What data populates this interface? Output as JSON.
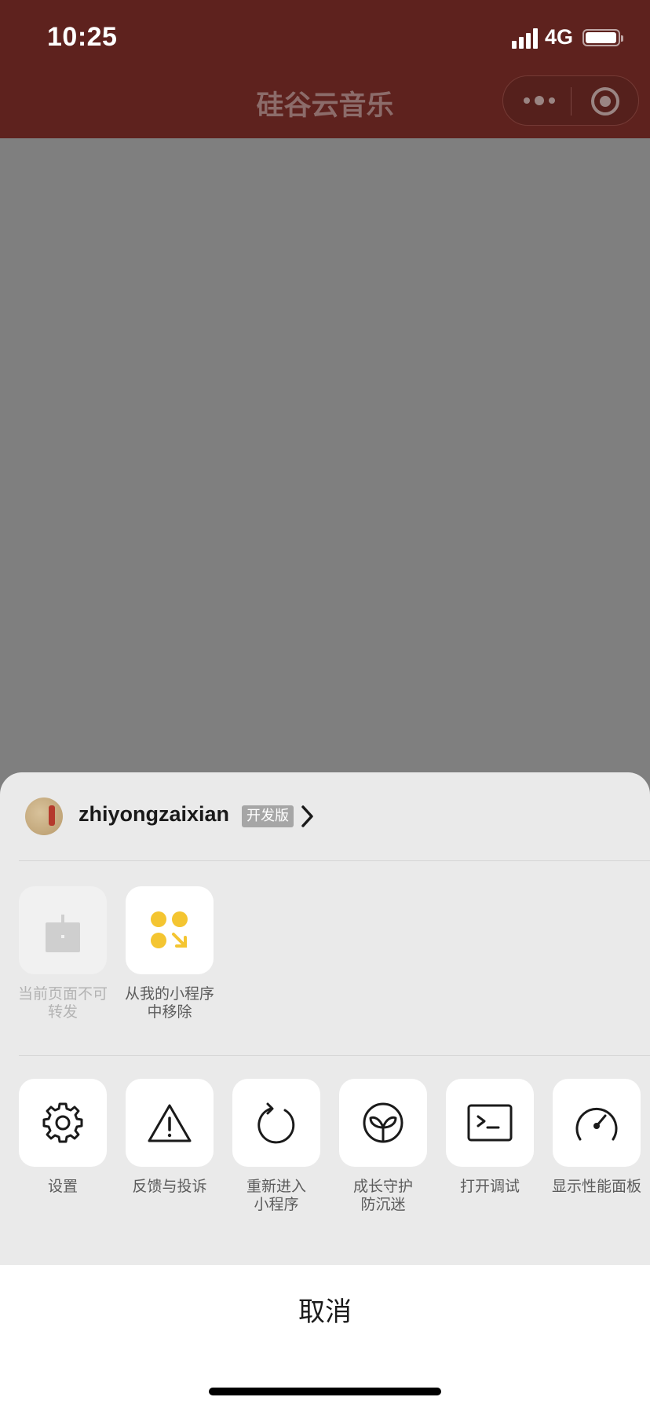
{
  "status_bar": {
    "time": "10:25",
    "network": "4G"
  },
  "nav": {
    "title": "硅谷云音乐"
  },
  "sheet": {
    "profile": {
      "username": "zhiyongzaixian",
      "badge": "开发版"
    },
    "row1": [
      {
        "label": "当前页面不可\n转发",
        "icon": "share-icon",
        "disabled": true
      },
      {
        "label": "从我的小程序\n中移除",
        "icon": "remove-miniprogram-icon",
        "disabled": false
      }
    ],
    "row2": [
      {
        "label": "设置",
        "icon": "gear-icon"
      },
      {
        "label": "反馈与投诉",
        "icon": "warning-icon"
      },
      {
        "label": "重新进入\n小程序",
        "icon": "refresh-icon"
      },
      {
        "label": "成长守护\n防沉迷",
        "icon": "sprout-icon"
      },
      {
        "label": "打开调试",
        "icon": "terminal-icon"
      },
      {
        "label": "显示性能面板",
        "icon": "gauge-icon"
      }
    ],
    "cancel": "取消"
  },
  "colors": {
    "header_bg": "#5e221e",
    "overlay": "#7f7f7f",
    "sheet_bg": "#eaeaea",
    "accent_yellow": "#f4c531"
  }
}
